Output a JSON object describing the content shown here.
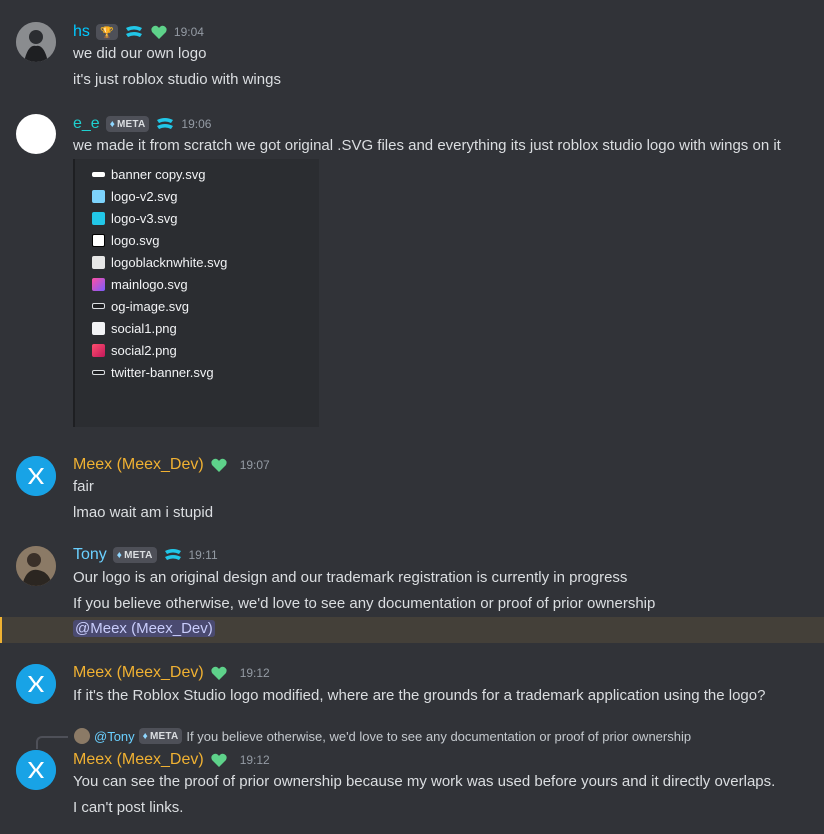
{
  "messages": {
    "hs": {
      "author": "hs",
      "time": "19:04",
      "lines": [
        "we did our own logo",
        "it's just roblox studio with wings"
      ]
    },
    "ee": {
      "author": "e_e",
      "tag": "META",
      "time": "19:06",
      "lines": [
        "we made it from scratch we got original .SVG files and everything its just roblox studio logo with wings on it"
      ],
      "files": [
        {
          "name": "banner copy.svg",
          "icon": "banner-icon"
        },
        {
          "name": "logo-v2.svg",
          "icon": "logo-icon"
        },
        {
          "name": "logo-v3.svg",
          "icon": "logo-icon"
        },
        {
          "name": "logo.svg",
          "icon": "logo-icon"
        },
        {
          "name": "logoblacknwhite.svg",
          "icon": "logo-icon"
        },
        {
          "name": "mainlogo.svg",
          "icon": "logo-icon"
        },
        {
          "name": "og-image.svg",
          "icon": "banner-icon"
        },
        {
          "name": "social1.png",
          "icon": "logo-icon"
        },
        {
          "name": "social2.png",
          "icon": "logo-icon"
        },
        {
          "name": "twitter-banner.svg",
          "icon": "banner-icon"
        }
      ]
    },
    "meex1": {
      "author": "Meex (Meex_Dev)",
      "time": "19:07",
      "lines": [
        "fair",
        "lmao wait am i stupid"
      ]
    },
    "tony": {
      "author": "Tony",
      "tag": "META",
      "time": "19:11",
      "lines": [
        "Our logo is an original design and our trademark registration is currently in progress",
        "If you believe otherwise, we'd love to see any documentation or proof of prior ownership"
      ],
      "mention": "@Meex (Meex_Dev)"
    },
    "meex2": {
      "author": "Meex (Meex_Dev)",
      "time": "19:12",
      "lines": [
        "If it's the Roblox Studio logo modified, where are the grounds for a trademark application using the logo?"
      ]
    },
    "meex3": {
      "reply_author": "@Tony",
      "reply_tag": "META",
      "reply_text": "If you believe otherwise, we'd love to see any documentation or proof of prior ownership",
      "author": "Meex (Meex_Dev)",
      "time": "19:12",
      "lines": [
        "You can see the proof of prior ownership because my work was used before yours and it directly overlaps.",
        "I can't post links."
      ]
    }
  },
  "colors": {
    "background": "#313338",
    "hs_name": "#00c8ff",
    "ee_name": "#1fd0cf",
    "meex_name": "#f0b132",
    "tony_name": "#6ad0ff",
    "mention_highlight": "#444039",
    "mention_bar": "#f0b232"
  }
}
